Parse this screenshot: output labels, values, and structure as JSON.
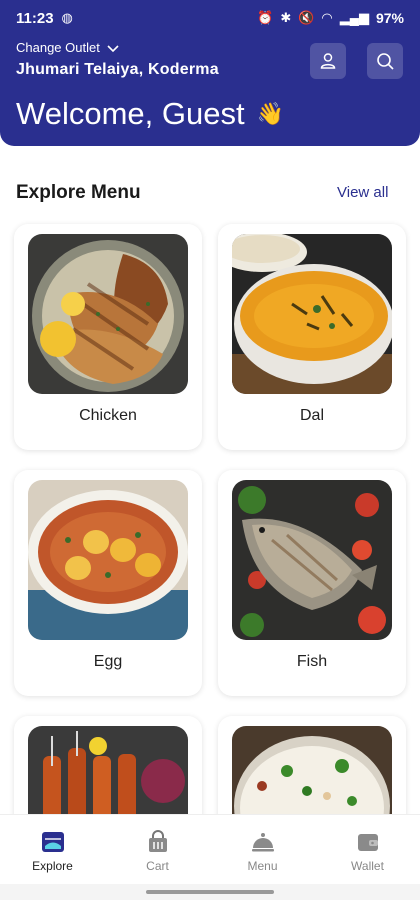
{
  "status": {
    "time": "11:23",
    "battery": "97%"
  },
  "header": {
    "outlet_label": "Change Outlet",
    "location": "Jhumari Telaiya, Koderma",
    "welcome": "Welcome, Guest",
    "wave_emoji": "👋"
  },
  "section": {
    "title": "Explore Menu",
    "view_all": "View all"
  },
  "menu": {
    "items": [
      {
        "label": "Chicken"
      },
      {
        "label": "Dal"
      },
      {
        "label": "Egg"
      },
      {
        "label": "Fish"
      },
      {
        "label": ""
      },
      {
        "label": ""
      }
    ]
  },
  "nav": {
    "items": [
      {
        "label": "Explore",
        "active": true
      },
      {
        "label": "Cart"
      },
      {
        "label": "Menu"
      },
      {
        "label": "Wallet"
      }
    ]
  },
  "colors": {
    "primary": "#2a2f8f",
    "background": "#ffffff"
  }
}
